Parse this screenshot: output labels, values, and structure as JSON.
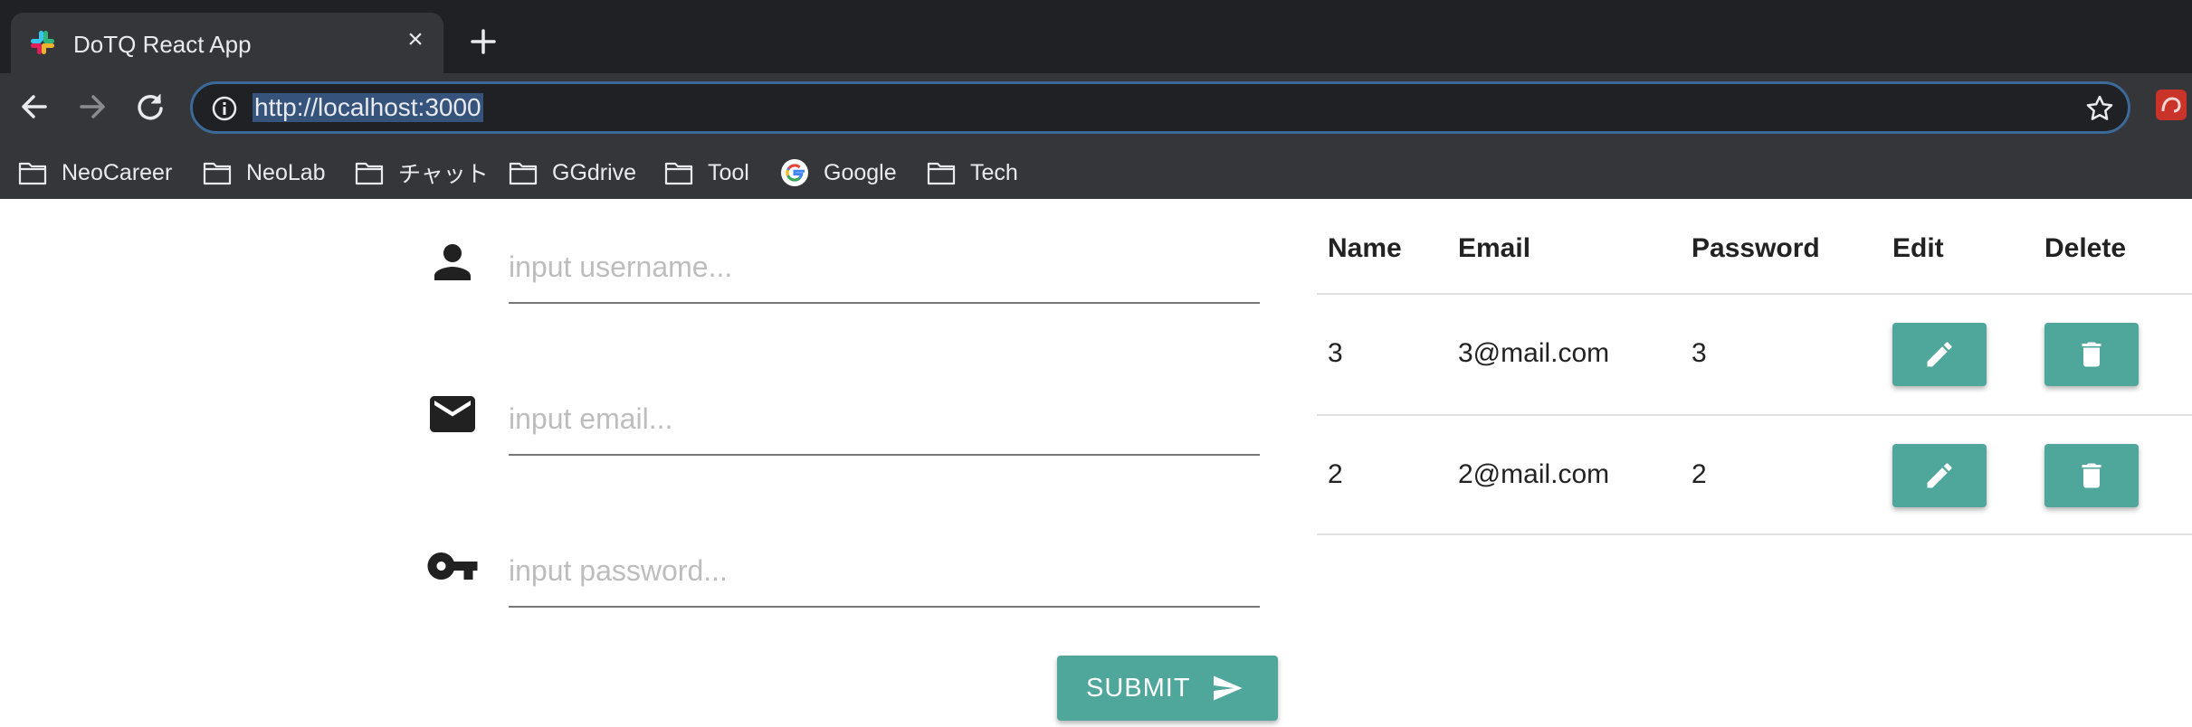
{
  "browser": {
    "tab": {
      "title": "DoTQ React App",
      "favicon": "slack-logo-icon"
    },
    "address_bar": {
      "url": "http://localhost:3000"
    },
    "bookmarks": [
      {
        "label": "NeoCareer",
        "icon": "folder-icon"
      },
      {
        "label": "NeoLab",
        "icon": "folder-icon"
      },
      {
        "label": "チャット",
        "icon": "folder-icon"
      },
      {
        "label": "GGdrive",
        "icon": "folder-icon"
      },
      {
        "label": "Tool",
        "icon": "folder-icon"
      },
      {
        "label": "Google",
        "icon": "google-icon"
      },
      {
        "label": "Tech",
        "icon": "folder-icon"
      }
    ]
  },
  "form": {
    "username": {
      "placeholder": "input username...",
      "value": "",
      "icon": "person-icon"
    },
    "email": {
      "placeholder": "input email...",
      "value": "",
      "icon": "mail-icon"
    },
    "password": {
      "placeholder": "input password...",
      "value": "",
      "icon": "key-icon"
    },
    "submit_label": "SUBMIT"
  },
  "table": {
    "headers": [
      "Name",
      "Email",
      "Password",
      "Edit",
      "Delete"
    ],
    "rows": [
      {
        "name": "3",
        "email": "3@mail.com",
        "password": "3"
      },
      {
        "name": "2",
        "email": "2@mail.com",
        "password": "2"
      }
    ]
  },
  "colors": {
    "accent": "#4fa69a",
    "chrome_dark": "#202124",
    "chrome_toolbar": "#35363a",
    "text": "#222222",
    "placeholder": "#bdbdbd"
  }
}
